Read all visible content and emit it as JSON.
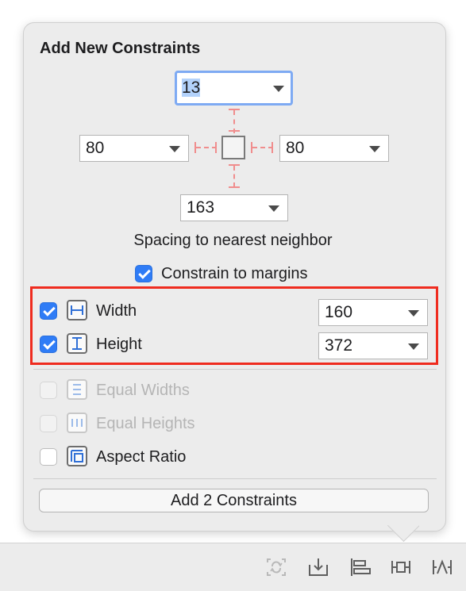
{
  "popover": {
    "title": "Add New Constraints",
    "spacing": {
      "top": "13",
      "left": "80",
      "right": "80",
      "bottom": "163",
      "label": "Spacing to nearest neighbor"
    },
    "constrain_to_margins": {
      "label": "Constrain to margins",
      "checked": true
    },
    "size_constraints": [
      {
        "label": "Width",
        "checked": true,
        "value": "160",
        "icon": "width-constraint-icon"
      },
      {
        "label": "Height",
        "checked": true,
        "value": "372",
        "icon": "height-constraint-icon"
      }
    ],
    "equal_options": [
      {
        "label": "Equal Widths",
        "checked": false,
        "enabled": false,
        "icon": "equal-widths-icon"
      },
      {
        "label": "Equal Heights",
        "checked": false,
        "enabled": false,
        "icon": "equal-heights-icon"
      },
      {
        "label": "Aspect Ratio",
        "checked": false,
        "enabled": true,
        "icon": "aspect-ratio-icon"
      }
    ],
    "add_button": "Add 2 Constraints"
  },
  "toolbar": {
    "icons": [
      "update-frames-icon",
      "embed-in-icon",
      "align-icon",
      "add-constraints-icon",
      "resolve-issues-icon"
    ]
  },
  "colors": {
    "accent": "#2f7cf6",
    "highlight_border": "#ef2c1f",
    "constraint_dash": "#f08d8d"
  }
}
